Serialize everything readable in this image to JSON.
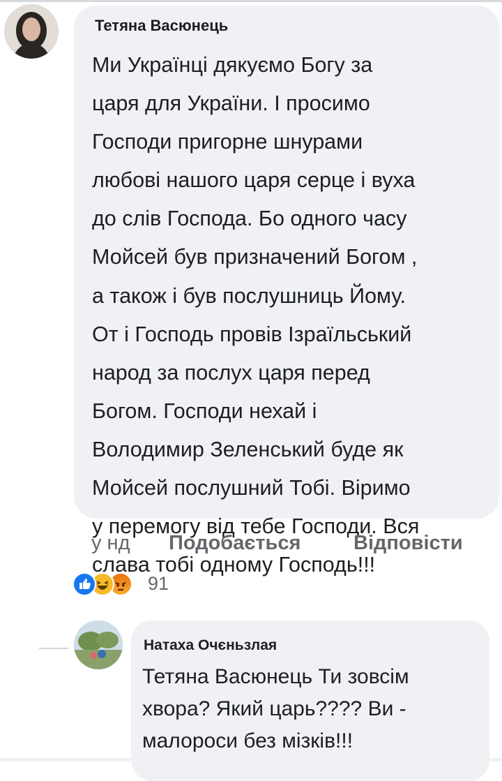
{
  "comment": {
    "author": "Тетяна Васюнець",
    "lines": [
      "Ми Українці дякуємо Богу за",
      "царя  для України. І просимо",
      "Господи пригорне шнурами",
      "любові нашого царя серце і вуха",
      "до слів Господа. Бо одного часу",
      "Мойсей був призначений Богом ,",
      "а також і був послушниць Йому.",
      "От і Господь провів Ізраїльський",
      "народ за послух царя перед",
      "Богом. Господи нехай і",
      "Володимир Зеленський буде як",
      "Мойсей послушний Тобі. Віримо",
      "у перемогу від тебе Господи. Вся",
      "слава тобі одному Господь!!!"
    ],
    "time": "у нд",
    "like_label": "Подобається",
    "reply_label": "Відповісти",
    "reaction_count": "91",
    "reaction_icons": [
      "like-icon",
      "haha-icon",
      "angry-icon"
    ]
  },
  "reply": {
    "author": "Натаха Очєньзлая",
    "lines": [
      "Тетяна Васюнець Ти зовсім",
      "хвора? Який царь???? Ви -",
      "малороси без мізків!!!"
    ]
  },
  "colors": {
    "bubble": "#eff1f4",
    "meta_text": "#65676b",
    "like_blue": "#1877f2",
    "haha_yellow": "#f7b928",
    "angry_orange": "#e9710f"
  }
}
